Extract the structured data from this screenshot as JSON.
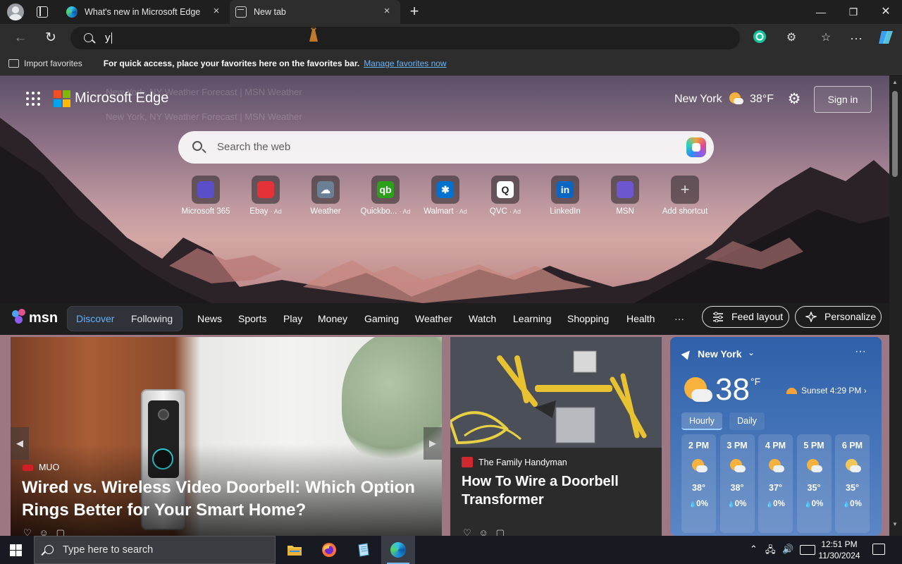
{
  "browser": {
    "tabs": [
      {
        "title": "What's new in Microsoft Edge",
        "active": false
      },
      {
        "title": "New tab",
        "active": true
      }
    ],
    "address_typed": "y",
    "favorites_bar": {
      "import_label": "Import favorites",
      "message": "For quick access, place your favorites here on the favorites bar.",
      "link": "Manage favorites now"
    }
  },
  "newtab": {
    "brand": "Microsoft Edge",
    "ghost_suggestions": [
      "New York, NY Weather Forecast | MSN Weather",
      "New York, NY Weather Forecast | MSN Weather"
    ],
    "location": "New York",
    "temp": "38°F",
    "sign_in": "Sign in",
    "search_placeholder": "Search the web",
    "shortcuts": [
      {
        "label": "Microsoft 365",
        "ad": "",
        "icon": "microsoft-365-icon",
        "color": "#5b4fc9",
        "glyph": ""
      },
      {
        "label": "Ebay",
        "ad": "· Ad",
        "icon": "ebay-icon",
        "color": "#e53238",
        "glyph": ""
      },
      {
        "label": "Weather",
        "ad": "",
        "icon": "weather-icon",
        "color": "#6b7f95",
        "glyph": "☁"
      },
      {
        "label": "Quickbo...",
        "ad": "· Ad",
        "icon": "quickbooks-icon",
        "color": "#2ca01c",
        "glyph": "qb"
      },
      {
        "label": "Walmart",
        "ad": "· Ad",
        "icon": "walmart-icon",
        "color": "#0071ce",
        "glyph": "✱"
      },
      {
        "label": "QVC",
        "ad": "· Ad",
        "icon": "qvc-icon",
        "color": "#ffffff",
        "glyph": "Q"
      },
      {
        "label": "LinkedIn",
        "ad": "",
        "icon": "linkedin-icon",
        "color": "#0a66c2",
        "glyph": "in"
      },
      {
        "label": "MSN",
        "ad": "",
        "icon": "msn-icon",
        "color": "#6e56cf",
        "glyph": ""
      },
      {
        "label": "Add shortcut",
        "ad": "",
        "icon": "add-shortcut-icon",
        "color": "#5a5054",
        "glyph": "+"
      }
    ]
  },
  "msn": {
    "logo": "msn",
    "discover": "Discover",
    "following": "Following",
    "nav": [
      "News",
      "Sports",
      "Play",
      "Money",
      "Gaming",
      "Weather",
      "Watch",
      "Learning",
      "Shopping",
      "Health"
    ],
    "more": "···",
    "feed_layout": "Feed layout",
    "personalize": "Personalize"
  },
  "cards": {
    "card1": {
      "source": "MUO",
      "source_badge": "MUO",
      "title": "Wired vs. Wireless Video Doorbell: Which Option Rings Better for Your Smart Home?"
    },
    "card2": {
      "source": "The Family Handyman",
      "title": "How To Wire a Doorbell Transformer"
    }
  },
  "weather": {
    "location": "New York",
    "temp": "38",
    "unit": "°F",
    "sunset": "Sunset 4:29 PM",
    "tabs": [
      "Hourly",
      "Daily"
    ],
    "hourly": [
      {
        "time": "2 PM",
        "temp": "38°",
        "precip": "0%",
        "icon": "partly-sunny-icon"
      },
      {
        "time": "3 PM",
        "temp": "38°",
        "precip": "0%",
        "icon": "partly-sunny-icon"
      },
      {
        "time": "4 PM",
        "temp": "37°",
        "precip": "0%",
        "icon": "partly-sunny-icon"
      },
      {
        "time": "5 PM",
        "temp": "35°",
        "precip": "0%",
        "icon": "partly-sunny-icon"
      },
      {
        "time": "6 PM",
        "temp": "35°",
        "precip": "0%",
        "icon": "partly-cloudy-night-icon"
      }
    ]
  },
  "taskbar": {
    "search_placeholder": "Type here to search",
    "time": "12:51 PM",
    "date": "11/30/2024"
  },
  "colors": {
    "accent": "#5fb2ff",
    "link": "#68b4f8",
    "card_bg": "#2b2b2b"
  }
}
